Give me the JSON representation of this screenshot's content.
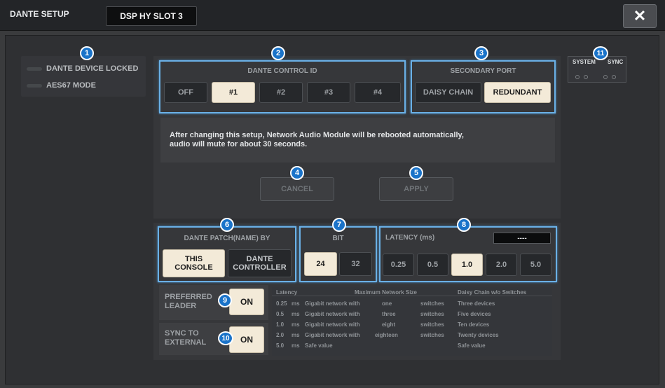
{
  "window": {
    "title": "DANTE SETUP",
    "slot_tab": "DSP HY SLOT 3",
    "close_glyph": "✕"
  },
  "status": {
    "locked_label": "DANTE DEVICE LOCKED",
    "aes67_label": "AES67 MODE"
  },
  "control_id": {
    "label": "DANTE CONTROL ID",
    "options": [
      "OFF",
      "#1",
      "#2",
      "#3",
      "#4"
    ],
    "selected": "#1"
  },
  "secondary_port": {
    "label": "SECONDARY PORT",
    "options": [
      "DAISY CHAIN",
      "REDUNDANT"
    ],
    "selected": "REDUNDANT"
  },
  "message": {
    "line1": "After changing this setup, Network Audio Module will be rebooted automatically,",
    "line2": "audio will mute for about 30 seconds."
  },
  "actions": {
    "cancel": "CANCEL",
    "apply": "APPLY"
  },
  "patch": {
    "label": "DANTE PATCH(NAME) BY",
    "this_console_1": "THIS",
    "this_console_2": "CONSOLE",
    "controller_1": "DANTE",
    "controller_2": "CONTROLLER",
    "selected": "THIS CONSOLE"
  },
  "bit": {
    "label": "BIT",
    "options": [
      "24",
      "32"
    ],
    "selected": "24"
  },
  "latency": {
    "label": "LATENCY (ms)",
    "display": "----",
    "options": [
      "0.25",
      "0.5",
      "1.0",
      "2.0",
      "5.0"
    ],
    "selected": "1.0"
  },
  "preferred_leader": {
    "label1": "PREFERRED",
    "label2": "LEADER",
    "button": "ON"
  },
  "sync_external": {
    "label1": "SYNC TO",
    "label2": "EXTERNAL",
    "button": "ON"
  },
  "system_sync": {
    "label1": "SYSTEM",
    "label2": "SYNC"
  },
  "table": {
    "headers": [
      "Latency",
      "Maximum Network Size",
      "Daisy Chain w/o Switches"
    ],
    "rows": [
      [
        "0.25",
        "ms",
        "Gigabit network with",
        "one",
        "switches",
        "Three devices"
      ],
      [
        "0.5",
        "ms",
        "Gigabit network with",
        "three",
        "switches",
        "Five devices"
      ],
      [
        "1.0",
        "ms",
        "Gigabit network with",
        "eight",
        "switches",
        "Ten devices"
      ],
      [
        "2.0",
        "ms",
        "Gigabit network with",
        "eighteen",
        "switches",
        "Twenty devices"
      ],
      [
        "5.0",
        "ms",
        "Safe value",
        "",
        "",
        "Safe value"
      ]
    ]
  },
  "badges": [
    "1",
    "2",
    "3",
    "4",
    "5",
    "6",
    "7",
    "8",
    "9",
    "10",
    "11"
  ],
  "colors": {
    "highlight": "#6ab0e6",
    "selected_button": "#f3ead8",
    "badge": "#1a73c9"
  }
}
